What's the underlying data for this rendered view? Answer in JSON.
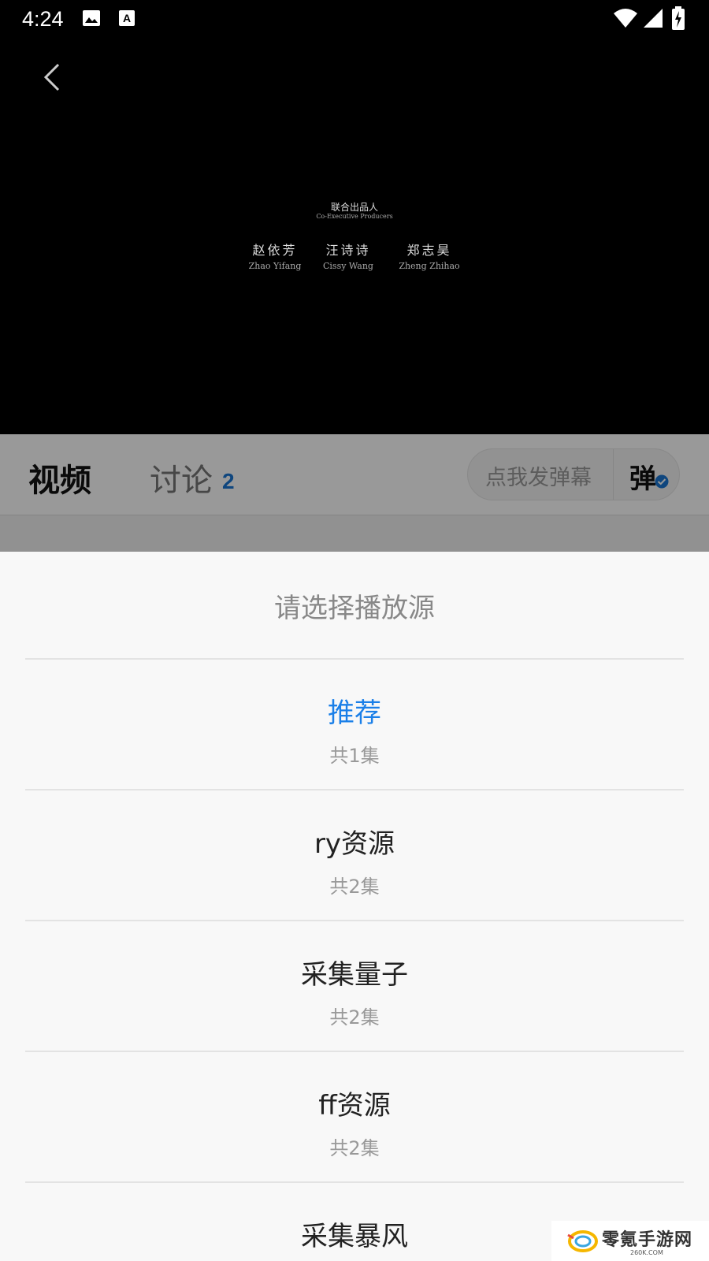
{
  "status_bar": {
    "time": "4:24",
    "icons": [
      "image-icon",
      "a-notification-icon",
      "wifi-icon",
      "signal-icon",
      "battery-charging-icon"
    ]
  },
  "video": {
    "back_icon": "chevron-left-icon",
    "credits": {
      "title": "联合出品人",
      "subtitle": "Co-Executive Producers",
      "people": [
        {
          "cn": "赵依芳",
          "en": "Zhao Yifang"
        },
        {
          "cn": "汪诗诗",
          "en": "Cissy Wang"
        },
        {
          "cn": "郑志昊",
          "en": "Zheng Zhihao"
        }
      ]
    }
  },
  "tabs": {
    "video_label": "视频",
    "discuss_label": "讨论",
    "discuss_badge": "2",
    "danmu_placeholder": "点我发弹幕",
    "danmu_toggle_label": "弹"
  },
  "sheet": {
    "title": "请选择播放源",
    "sources": [
      {
        "name": "推荐",
        "count": "共1集",
        "active": true
      },
      {
        "name": "ry资源",
        "count": "共2集",
        "active": false
      },
      {
        "name": "采集量子",
        "count": "共2集",
        "active": false
      },
      {
        "name": "ff资源",
        "count": "共2集",
        "active": false
      },
      {
        "name": "采集暴风",
        "count": "",
        "active": false
      }
    ]
  },
  "watermark": {
    "text": "零氪手游网",
    "sub": "260K.COM"
  },
  "colors": {
    "accent": "#1a7fe8",
    "badge": "#1976d2"
  }
}
